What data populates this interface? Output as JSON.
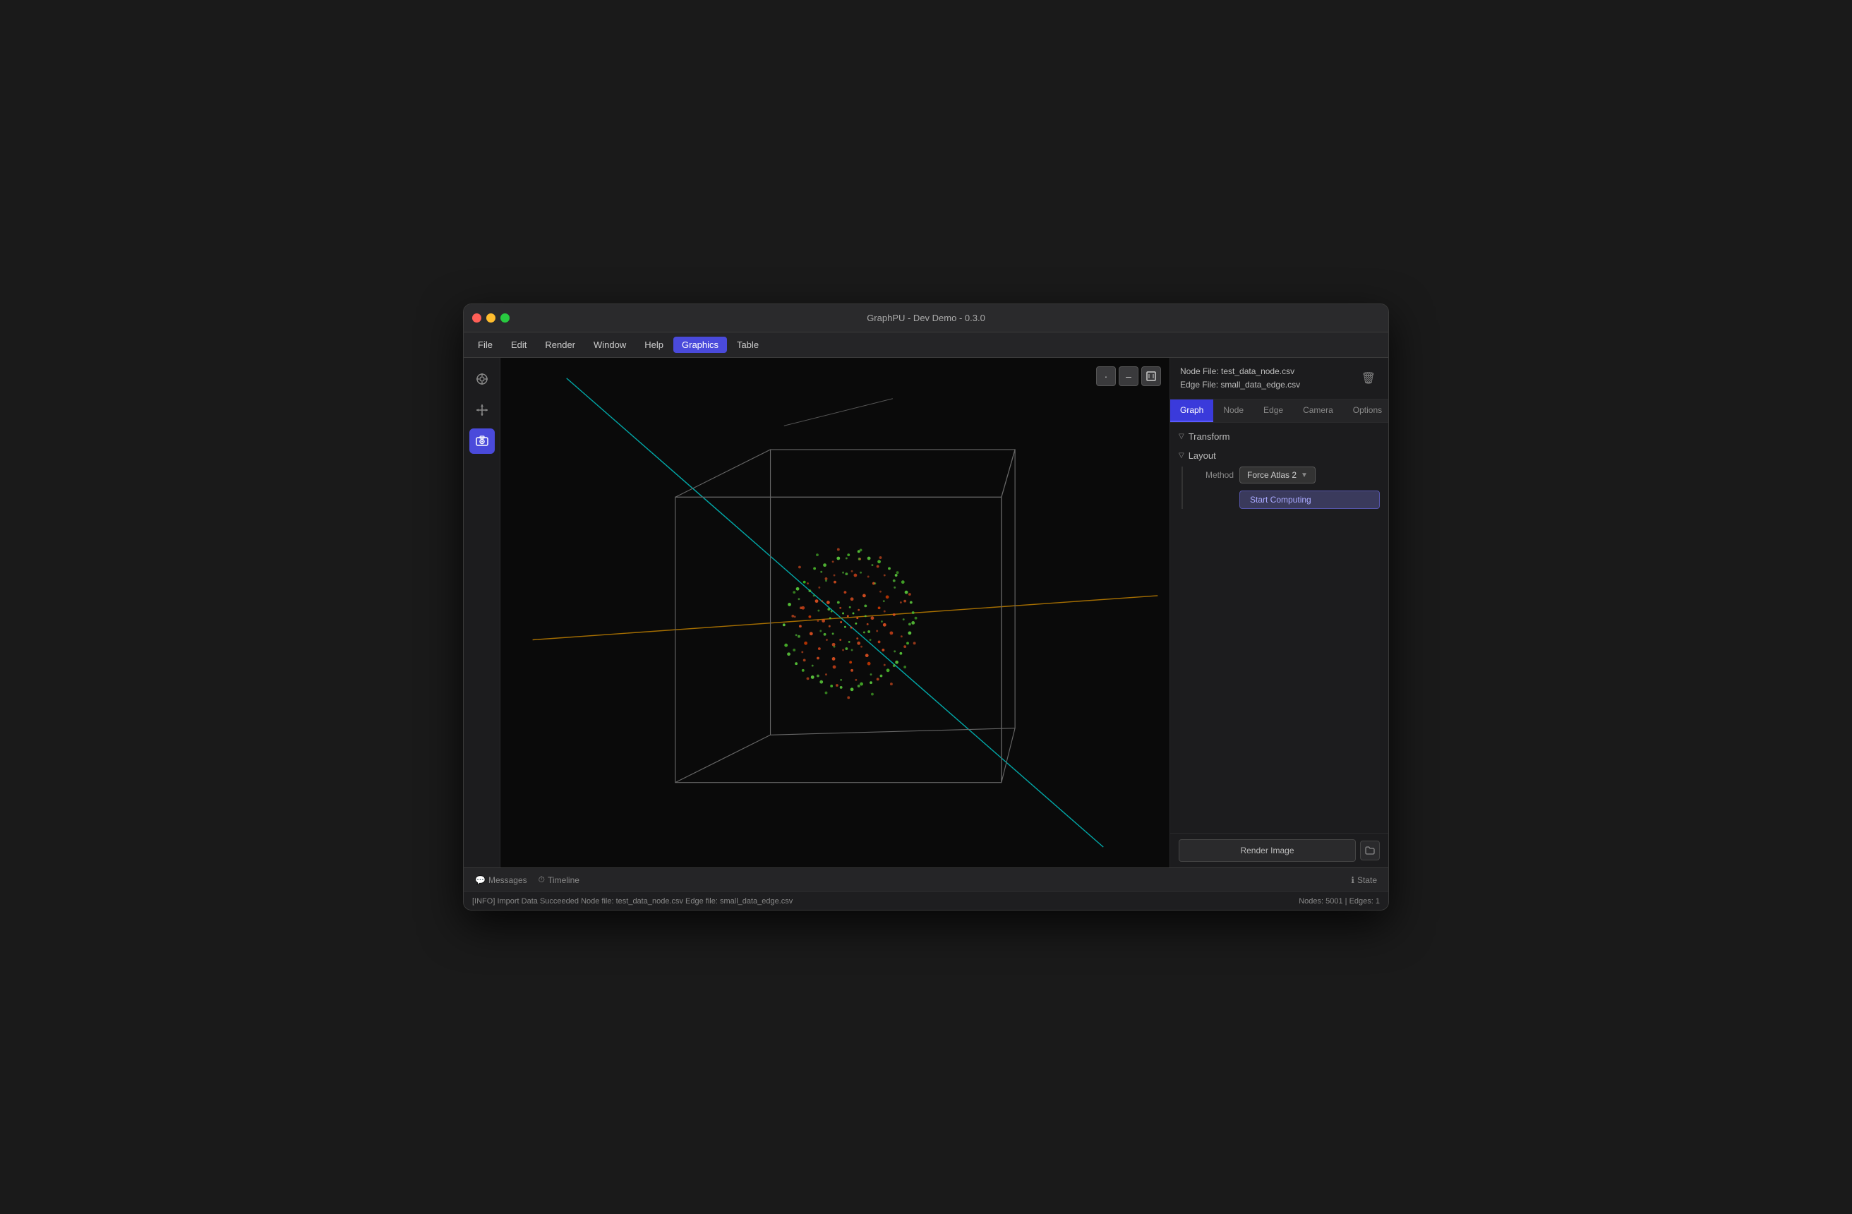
{
  "window": {
    "title": "GraphPU - Dev Demo - 0.3.0"
  },
  "menubar": {
    "items": [
      {
        "id": "file",
        "label": "File",
        "active": false
      },
      {
        "id": "edit",
        "label": "Edit",
        "active": false
      },
      {
        "id": "render",
        "label": "Render",
        "active": false
      },
      {
        "id": "window",
        "label": "Window",
        "active": false
      },
      {
        "id": "help",
        "label": "Help",
        "active": false
      },
      {
        "id": "graphics",
        "label": "Graphics",
        "active": true
      },
      {
        "id": "table",
        "label": "Table",
        "active": false
      }
    ]
  },
  "toolbar": {
    "tools": [
      {
        "id": "target",
        "icon": "◎",
        "active": false
      },
      {
        "id": "move",
        "icon": "✛",
        "active": false
      },
      {
        "id": "camera",
        "icon": "🎬",
        "active": true
      }
    ]
  },
  "viewport": {
    "controls": [
      {
        "id": "dot-view",
        "icon": "·"
      },
      {
        "id": "minus-view",
        "icon": "—"
      },
      {
        "id": "expand-view",
        "icon": "⛶"
      }
    ]
  },
  "panel": {
    "node_file": "Node File: test_data_node.csv",
    "edge_file": "Edge File: small_data_edge.csv",
    "tabs": [
      {
        "id": "graph",
        "label": "Graph",
        "active": true
      },
      {
        "id": "node",
        "label": "Node",
        "active": false
      },
      {
        "id": "edge",
        "label": "Edge",
        "active": false
      },
      {
        "id": "camera",
        "label": "Camera",
        "active": false
      },
      {
        "id": "options",
        "label": "Options",
        "active": false
      }
    ],
    "sections": {
      "transform": {
        "label": "Transform",
        "expanded": true
      },
      "layout": {
        "label": "Layout",
        "expanded": true,
        "method_label": "Method",
        "method_value": "Force Atlas 2",
        "start_computing": "Start Computing"
      }
    },
    "render_image": "Render Image"
  },
  "bottom_bar": {
    "messages": "Messages",
    "timeline": "Timeline",
    "state": "State"
  },
  "status_bar": {
    "info": "[INFO] Import Data Succeeded  Node file: test_data_node.csv   Edge file: small_data_edge.csv",
    "stats": "Nodes: 5001  |  Edges: 1"
  }
}
